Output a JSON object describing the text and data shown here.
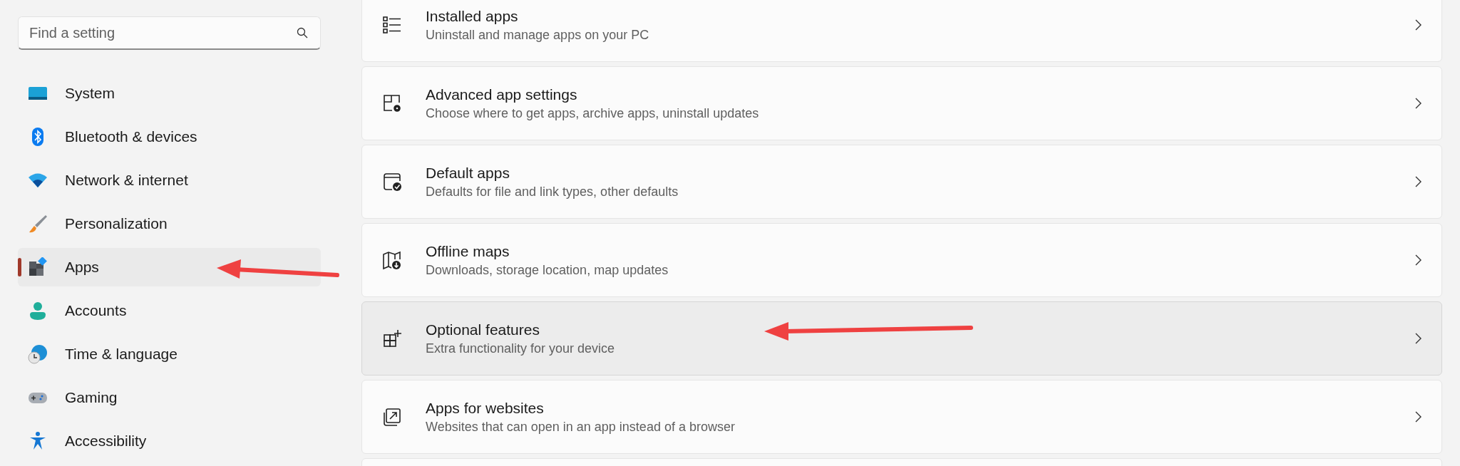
{
  "search": {
    "placeholder": "Find a setting"
  },
  "sidebar": {
    "items": [
      {
        "label": "System",
        "selected": false
      },
      {
        "label": "Bluetooth & devices",
        "selected": false
      },
      {
        "label": "Network & internet",
        "selected": false
      },
      {
        "label": "Personalization",
        "selected": false
      },
      {
        "label": "Apps",
        "selected": true
      },
      {
        "label": "Accounts",
        "selected": false
      },
      {
        "label": "Time & language",
        "selected": false
      },
      {
        "label": "Gaming",
        "selected": false
      },
      {
        "label": "Accessibility",
        "selected": false
      }
    ]
  },
  "settings": [
    {
      "title": "Installed apps",
      "description": "Uninstall and manage apps on your PC",
      "hovered": false
    },
    {
      "title": "Advanced app settings",
      "description": "Choose where to get apps, archive apps, uninstall updates",
      "hovered": false
    },
    {
      "title": "Default apps",
      "description": "Defaults for file and link types, other defaults",
      "hovered": false
    },
    {
      "title": "Offline maps",
      "description": "Downloads, storage location, map updates",
      "hovered": false
    },
    {
      "title": "Optional features",
      "description": "Extra functionality for your device",
      "hovered": true
    },
    {
      "title": "Apps for websites",
      "description": "Websites that can open in an app instead of a browser",
      "hovered": false
    }
  ]
}
